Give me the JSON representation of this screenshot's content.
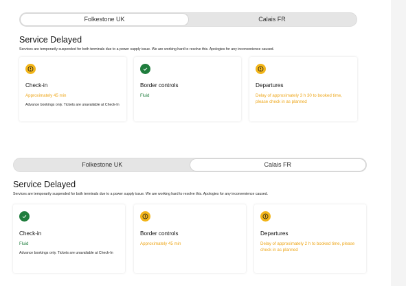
{
  "colors": {
    "warning": "#f2b51a",
    "ok": "#1f7d3d",
    "amber_text": "#eea71b"
  },
  "views": [
    {
      "tabs": [
        {
          "label": "Folkestone UK",
          "active": true
        },
        {
          "label": "Calais FR",
          "active": false
        }
      ],
      "title": "Service Delayed",
      "description": "Services are temporarily suspended for both terminals due to a power supply issue. We are working hard to resolve this. Apologies for any inconvenience caused.",
      "cards": [
        {
          "icon": "warning-icon",
          "title": "Check-in",
          "status": "Approximately 45 min",
          "status_color": "amber",
          "note": "Advance bookings only. Tickets are unavailable at Check-In"
        },
        {
          "icon": "checkmark-icon",
          "title": "Border controls",
          "status": "Fluid",
          "status_color": "green",
          "note": ""
        },
        {
          "icon": "warning-icon",
          "title": "Departures",
          "status": "Delay of approximately 3 h 30 to booked time, please check in as planned",
          "status_color": "amber",
          "note": ""
        }
      ]
    },
    {
      "tabs": [
        {
          "label": "Folkestone UK",
          "active": false
        },
        {
          "label": "Calais FR",
          "active": true
        }
      ],
      "title": "Service Delayed",
      "description": "Services are temporarily suspended for both terminals due to a power supply issue. We are working hard to resolve this. Apologies for any inconvenience caused.",
      "cards": [
        {
          "icon": "checkmark-icon",
          "title": "Check-in",
          "status": "Fluid",
          "status_color": "green",
          "note": "Advance bookings only. Tickets are unavailable at Check-In"
        },
        {
          "icon": "warning-icon",
          "title": "Border controls",
          "status": "Approximately 45 min",
          "status_color": "amber",
          "note": ""
        },
        {
          "icon": "warning-icon",
          "title": "Departures",
          "status": "Delay of approximately 2 h to booked time, please check in as planned",
          "status_color": "amber",
          "note": ""
        }
      ]
    }
  ]
}
